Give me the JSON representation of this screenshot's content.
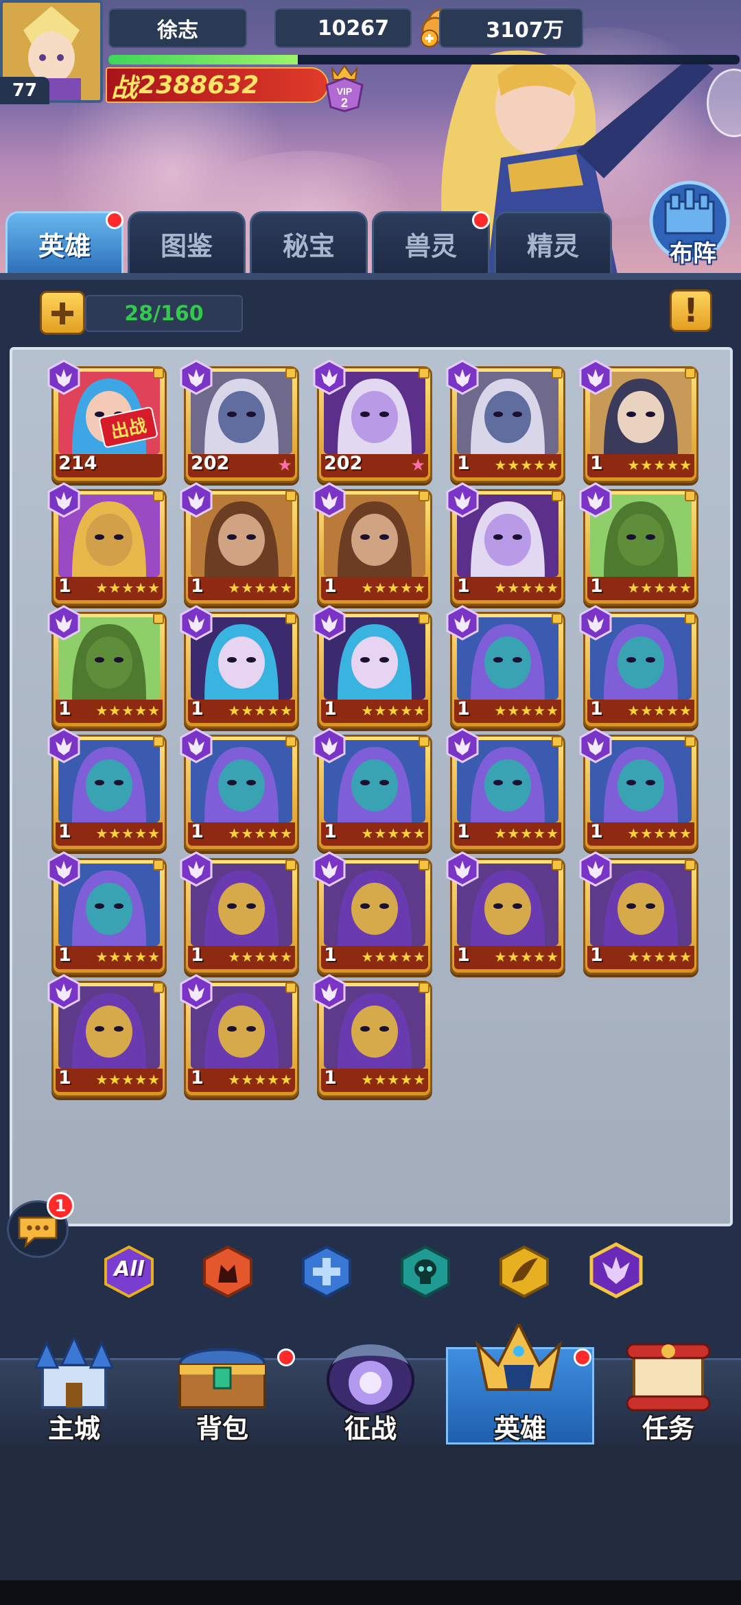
{
  "player": {
    "name": "徐志",
    "level": "77",
    "gems": "10267",
    "gold": "3107万",
    "power_label": "战",
    "power": "2388632",
    "vip": "VIP",
    "vip_level": "2",
    "exp_fraction": 0.3
  },
  "formation_button": "布阵",
  "tabs": [
    {
      "label": "英雄",
      "active": true,
      "notification": true
    },
    {
      "label": "图鉴",
      "active": false,
      "notification": false
    },
    {
      "label": "秘宝",
      "active": false,
      "notification": false
    },
    {
      "label": "兽灵",
      "active": false,
      "notification": true
    },
    {
      "label": "精灵",
      "active": false,
      "notification": false
    }
  ],
  "roster": {
    "capacity": "28/160",
    "info_icon": "exclamation-icon",
    "add_icon": "plus-icon",
    "heroes": [
      {
        "level": "214",
        "stars": 0,
        "portrait": "blue-haired-pirate",
        "deployed_label": "出战"
      },
      {
        "level": "202",
        "stars": 1,
        "star_color": "pink",
        "portrait": "silver-haired-dark-elf"
      },
      {
        "level": "202",
        "stars": 1,
        "star_color": "pink",
        "portrait": "purple-archer-elf"
      },
      {
        "level": "1",
        "stars": 5,
        "portrait": "silver-haired-dark-elf"
      },
      {
        "level": "1",
        "stars": 5,
        "portrait": "horned-helmet-priestess"
      },
      {
        "level": "1",
        "stars": 5,
        "portrait": "gold-masked-sorcerer"
      },
      {
        "level": "1",
        "stars": 5,
        "portrait": "bronze-armored-warrior"
      },
      {
        "level": "1",
        "stars": 5,
        "portrait": "bronze-armored-warrior"
      },
      {
        "level": "1",
        "stars": 5,
        "portrait": "purple-archer-elf"
      },
      {
        "level": "1",
        "stars": 5,
        "portrait": "green-toad"
      },
      {
        "level": "1",
        "stars": 5,
        "portrait": "green-toad"
      },
      {
        "level": "1",
        "stars": 5,
        "portrait": "blue-haired-sorceress"
      },
      {
        "level": "1",
        "stars": 5,
        "portrait": "blue-haired-sorceress"
      },
      {
        "level": "1",
        "stars": 5,
        "portrait": "blue-skinned-witch"
      },
      {
        "level": "1",
        "stars": 5,
        "portrait": "blue-skinned-witch"
      },
      {
        "level": "1",
        "stars": 5,
        "portrait": "blue-skinned-witch"
      },
      {
        "level": "1",
        "stars": 5,
        "portrait": "blue-skinned-witch"
      },
      {
        "level": "1",
        "stars": 5,
        "portrait": "blue-skinned-witch"
      },
      {
        "level": "1",
        "stars": 5,
        "portrait": "blue-skinned-witch"
      },
      {
        "level": "1",
        "stars": 5,
        "portrait": "blue-skinned-witch"
      },
      {
        "level": "1",
        "stars": 5,
        "portrait": "blue-skinned-witch"
      },
      {
        "level": "1",
        "stars": 5,
        "portrait": "hooded-gold-mask"
      },
      {
        "level": "1",
        "stars": 5,
        "portrait": "hooded-gold-mask"
      },
      {
        "level": "1",
        "stars": 5,
        "portrait": "hooded-gold-mask"
      },
      {
        "level": "1",
        "stars": 5,
        "portrait": "hooded-gold-mask"
      },
      {
        "level": "1",
        "stars": 5,
        "portrait": "hooded-gold-mask"
      },
      {
        "level": "1",
        "stars": 5,
        "portrait": "hooded-gold-mask"
      },
      {
        "level": "1",
        "stars": 5,
        "portrait": "hooded-gold-mask"
      }
    ]
  },
  "chat": {
    "badge": "1"
  },
  "filters": [
    {
      "label": "All",
      "icon": "all-faction-icon",
      "color": "#7a3fd1"
    },
    {
      "label": "",
      "icon": "fire-demon-faction-icon",
      "color": "#e4562b"
    },
    {
      "label": "",
      "icon": "holy-cross-faction-icon",
      "color": "#3a78d6"
    },
    {
      "label": "",
      "icon": "skull-faction-icon",
      "color": "#1f9b93"
    },
    {
      "label": "",
      "icon": "nature-wing-faction-icon",
      "color": "#e6b020"
    },
    {
      "label": "",
      "icon": "dark-wing-faction-icon",
      "color": "#6a2ab8"
    }
  ],
  "nav": [
    {
      "label": "主城",
      "icon": "castle-icon",
      "active": false,
      "notification": false
    },
    {
      "label": "背包",
      "icon": "treasure-chest-icon",
      "active": false,
      "notification": true
    },
    {
      "label": "征战",
      "icon": "dragon-portal-icon",
      "active": false,
      "notification": false
    },
    {
      "label": "英雄",
      "icon": "hero-helmet-icon",
      "active": true,
      "notification": true
    },
    {
      "label": "任务",
      "icon": "scroll-icon",
      "active": false,
      "notification": false
    }
  ],
  "colors": {
    "accent_blue": "#3f8ee0",
    "gold": "#ffd23a",
    "power_red": "#d61c2b",
    "capacity_green": "#32c94c",
    "notification_red": "#ff2b2b"
  }
}
